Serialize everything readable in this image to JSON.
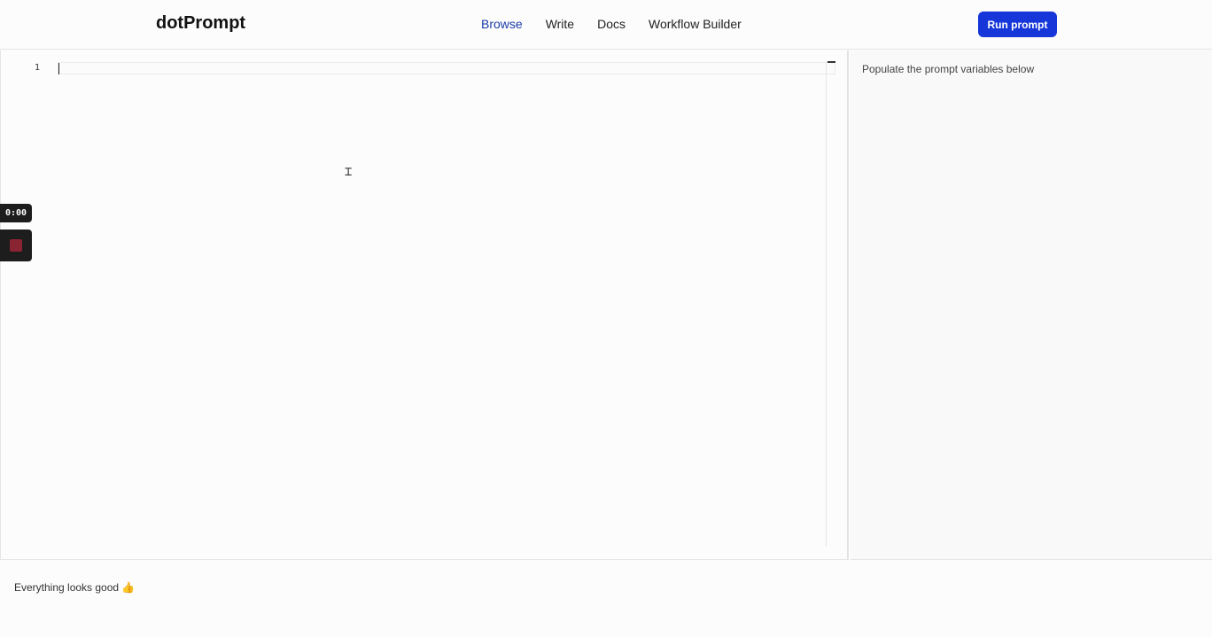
{
  "header": {
    "brand": "dotPrompt",
    "nav": [
      {
        "label": "Browse",
        "active": true
      },
      {
        "label": "Write",
        "active": false
      },
      {
        "label": "Docs",
        "active": false
      },
      {
        "label": "Workflow Builder",
        "active": false
      }
    ],
    "run_label": "Run prompt"
  },
  "editor": {
    "line_numbers": [
      "1"
    ],
    "content": ""
  },
  "variables_panel": {
    "hint": "Populate the prompt variables below"
  },
  "status": {
    "message": "Everything looks good 👍"
  },
  "recorder": {
    "time": "0:00"
  },
  "colors": {
    "accent": "#1636d9",
    "nav_active": "#1a3aa8",
    "record_stop": "#8a2332"
  }
}
